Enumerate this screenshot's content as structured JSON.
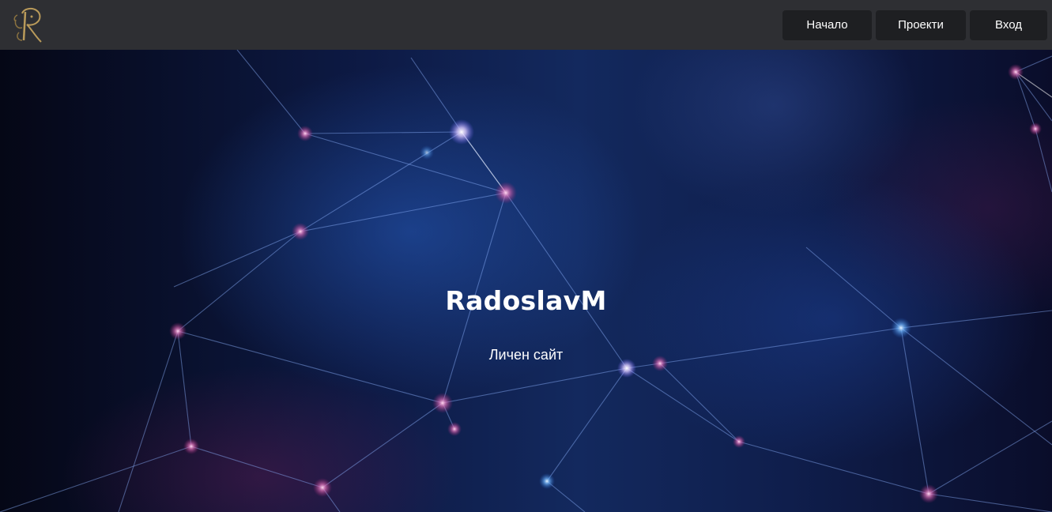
{
  "nav": {
    "logo": "R-logo",
    "buttons": [
      {
        "label": "Начало"
      },
      {
        "label": "Проекти"
      },
      {
        "label": "Вход"
      }
    ]
  },
  "hero": {
    "title": "RadoslavM",
    "subtitle": "Личен сайт"
  },
  "colors": {
    "navbar": "#2e2f33",
    "nav_button": "#1e1f22",
    "logo_gold": "#b99a5a",
    "text": "#ffffff"
  }
}
